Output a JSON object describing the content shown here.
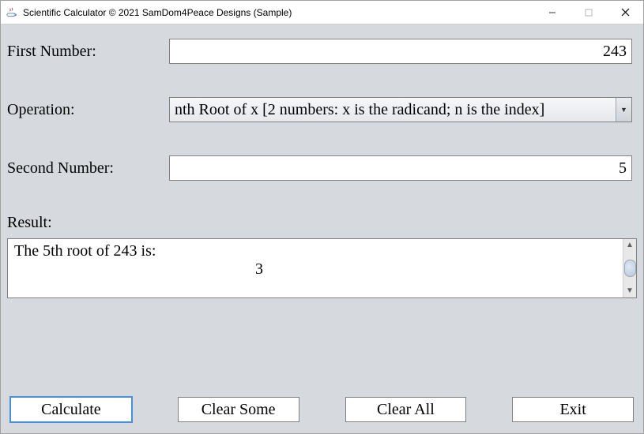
{
  "window": {
    "title": "Scientific Calculator © 2021 SamDom4Peace Designs (Sample)"
  },
  "labels": {
    "first_number": "First Number:",
    "operation": "Operation:",
    "second_number": "Second Number:",
    "result": "Result:"
  },
  "fields": {
    "first_number_value": "243",
    "operation_selected": "nth Root of x [2 numbers: x is the radicand; n is the index]",
    "second_number_value": "5"
  },
  "result": {
    "line1": "The 5th root of 243 is:",
    "line2": "3"
  },
  "buttons": {
    "calculate": "Calculate",
    "clear_some": "Clear Some",
    "clear_all": "Clear All",
    "exit": "Exit"
  }
}
